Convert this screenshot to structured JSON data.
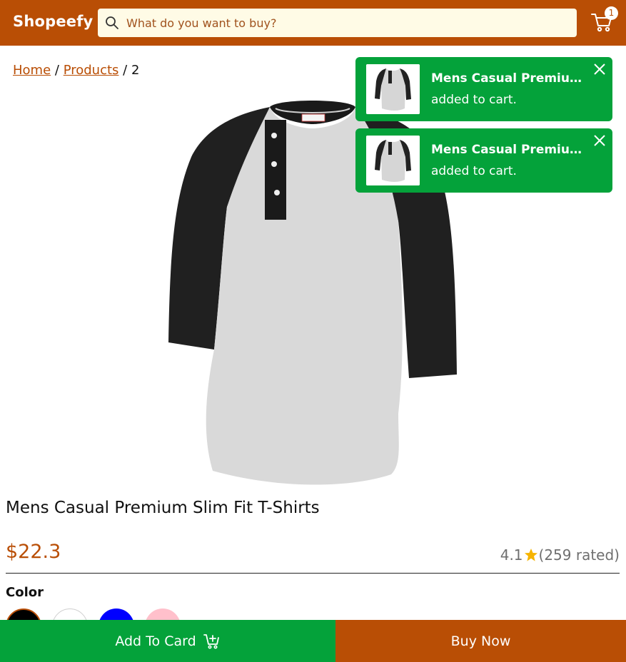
{
  "header": {
    "logo": "Shopeefy",
    "search_placeholder": "What do you want to buy?",
    "cart_count": "1",
    "icons": [
      "search-icon",
      "cart-icon"
    ]
  },
  "breadcrumb": {
    "home": "Home",
    "products": "Products",
    "separator": "/",
    "current": "2"
  },
  "toasts": [
    {
      "title": "Mens Casual Premium Slim Fit T-Shirts",
      "message": "added to cart."
    },
    {
      "title": "Mens Casual Premium Slim Fit T-Shirts",
      "message": "added to cart."
    }
  ],
  "product": {
    "title": "Mens Casual Premium Slim Fit T-Shirts",
    "price": "$22.3",
    "rating_value": "4.1",
    "rating_count": "(259 rated)",
    "color_label": "Color",
    "colors": [
      "#000000",
      "#ffffff",
      "#0000ff",
      "#ffc0cb"
    ],
    "selected_color": "#000000"
  },
  "actions": {
    "add_to_cart": "Add To Card",
    "buy_now": "Buy Now"
  },
  "theme": {
    "brand": "#b94e05",
    "success": "#04a23a",
    "search_bg": "#fffbe6",
    "star": "#f6b400"
  }
}
